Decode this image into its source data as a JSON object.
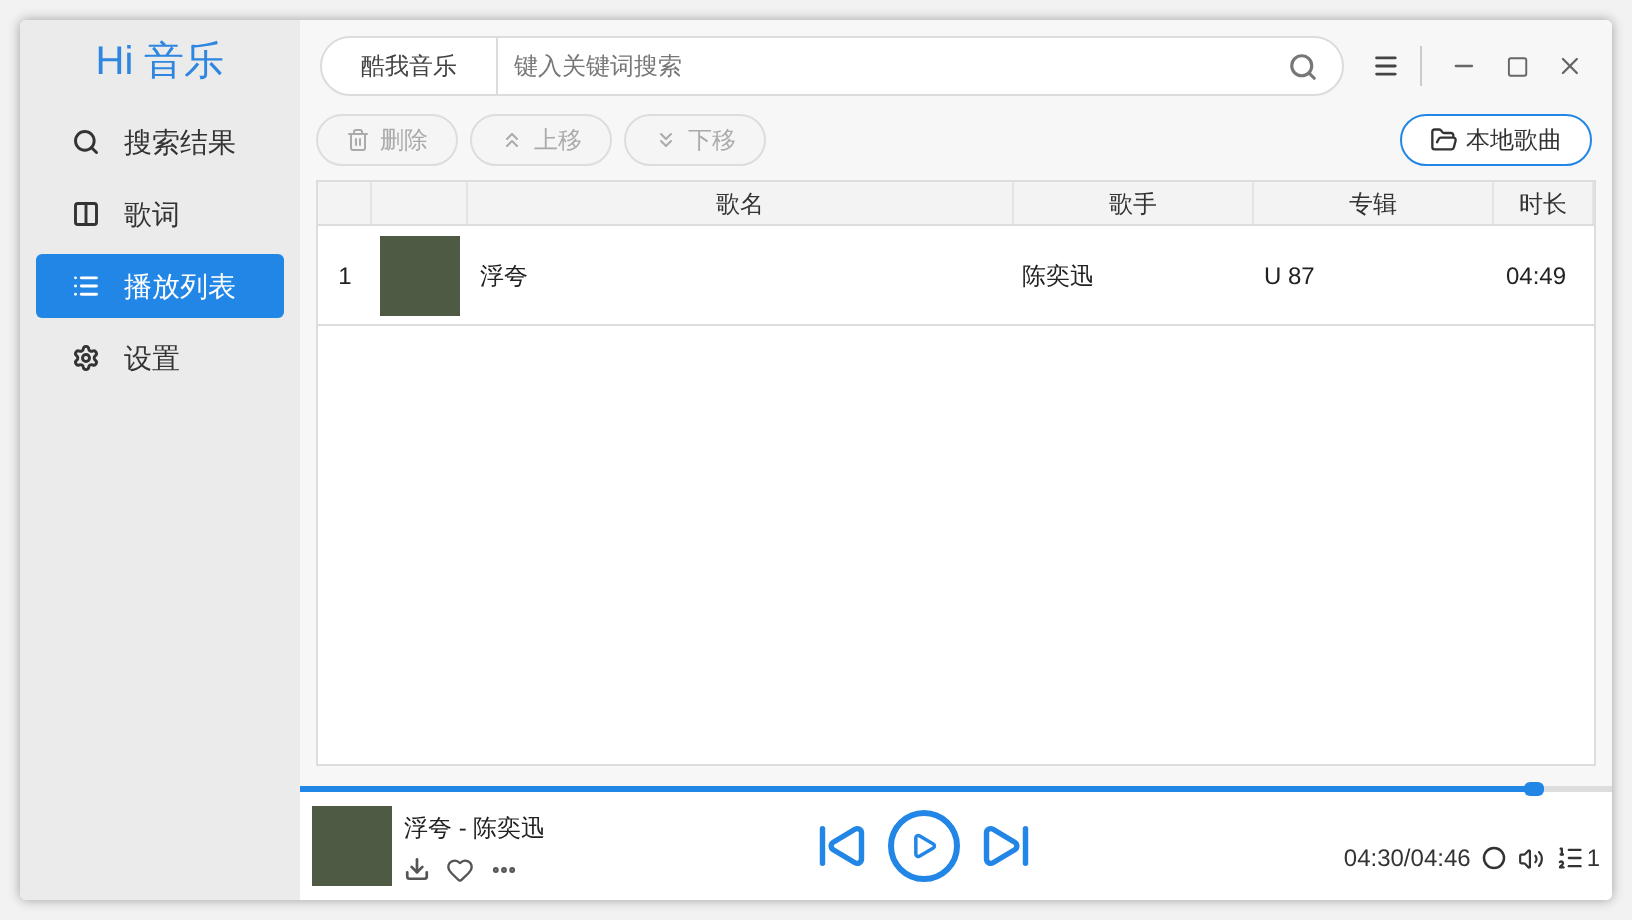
{
  "window": {
    "app_title": "Hi 音乐"
  },
  "sidebar": {
    "items": [
      {
        "label": "搜索结果",
        "selected": false
      },
      {
        "label": "歌词",
        "selected": false
      },
      {
        "label": "播放列表",
        "selected": true
      },
      {
        "label": "设置",
        "selected": false
      }
    ]
  },
  "search": {
    "source": "酷我音乐",
    "placeholder": "键入关键词搜索"
  },
  "toolbar": {
    "buttons": [
      {
        "label": "删除",
        "disabled": true
      },
      {
        "label": "上移",
        "disabled": true
      },
      {
        "label": "下移",
        "disabled": true
      }
    ],
    "local_button": "本地歌曲"
  },
  "table": {
    "columns": [
      "歌名",
      "歌手",
      "专辑",
      "时长"
    ],
    "rows": [
      {
        "index": "1",
        "title": "浮夸",
        "singer": "陈奕迅",
        "album": "U 87",
        "duration": "04:49"
      }
    ]
  },
  "player": {
    "now_playing": "浮夸 - 陈奕迅",
    "progress": {
      "level": 0.94
    },
    "time": "04:30/04:46",
    "playlist_count": "1"
  }
}
